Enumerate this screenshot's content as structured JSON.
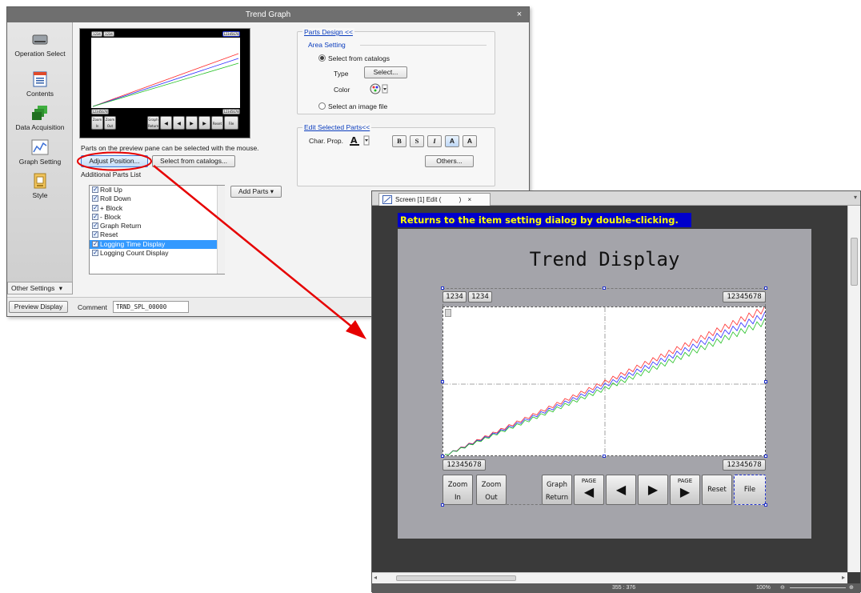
{
  "dialog": {
    "title": "Trend Graph",
    "close": "×",
    "sidebar": [
      {
        "label": "Operation Select",
        "icon": "drive-icon"
      },
      {
        "label": "Contents",
        "icon": "document-icon"
      },
      {
        "label": "Data Acquisition",
        "icon": "data-blocks-icon"
      },
      {
        "label": "Graph Setting",
        "icon": "graph-icon"
      },
      {
        "label": "Style",
        "icon": "style-icon"
      }
    ],
    "other_settings": "Other Settings",
    "preview_display": "Preview Display",
    "comment_label": "Comment",
    "comment_value": "TRND_SPL_00000",
    "hint": "Parts on the preview pane can be selected with the mouse.",
    "adjust_position": "Adjust Position...",
    "select_from_catalogs_btn": "Select from catalogs...",
    "additional_parts_label": "Additional Parts List",
    "add_parts": "Add Parts",
    "parts": [
      {
        "label": "Roll Up",
        "selected": false
      },
      {
        "label": "Roll Down",
        "selected": false
      },
      {
        "label": "+ Block",
        "selected": false
      },
      {
        "label": "- Block",
        "selected": false
      },
      {
        "label": "Graph Return",
        "selected": false
      },
      {
        "label": "Reset",
        "selected": false
      },
      {
        "label": "Logging Time Display",
        "selected": true
      },
      {
        "label": "Logging Count Display",
        "selected": false
      }
    ],
    "parts_design": {
      "header": "Parts Design <<",
      "area_setting": "Area Setting",
      "select_from_catalogs": "Select from catalogs",
      "type_label": "Type",
      "type_button": "Select...",
      "color_label": "Color",
      "select_image": "Select an image file"
    },
    "edit_parts": {
      "header": "Edit Selected Parts<<",
      "char_prop": "Char. Prop.",
      "bold": "B",
      "shadow": "S",
      "italic": "I",
      "a1": "A",
      "a2": "A",
      "others": "Others..."
    },
    "preview": {
      "d1": "1234",
      "d2": "1234",
      "d3": "12345678",
      "d4": "12345678",
      "d5": "12345678",
      "zoom_in": "Zoom In",
      "zoom_out": "Zoom Out",
      "graph_return": "Graph Return",
      "page": "PAGE",
      "reset": "Reset",
      "file": "File"
    }
  },
  "editor": {
    "tab_title": "Screen [1] Edit (",
    "tab_paren": ")",
    "tab_close": "×",
    "banner": "Returns to the item setting dialog by double-clicking.",
    "title": "Trend Display",
    "top_left_1": "1234",
    "top_left_2": "1234",
    "top_right": "12345678",
    "bottom_left": "12345678",
    "bottom_right": "12345678",
    "zoom": "Zoom",
    "in": "In",
    "out": "Out",
    "graph": "Graph",
    "return": "Return",
    "page": "PAGE",
    "reset": "Reset",
    "file": "File",
    "status_coords": "355 : 376",
    "status_zoom": "100%"
  },
  "colors": {
    "accent_red": "#e60000",
    "banner_bg": "#0000cc",
    "banner_text": "#ffff00",
    "series_red": "#ff2a2a",
    "series_blue": "#2a2aff",
    "series_green": "#22c022",
    "selection_blue": "#3399ff"
  }
}
